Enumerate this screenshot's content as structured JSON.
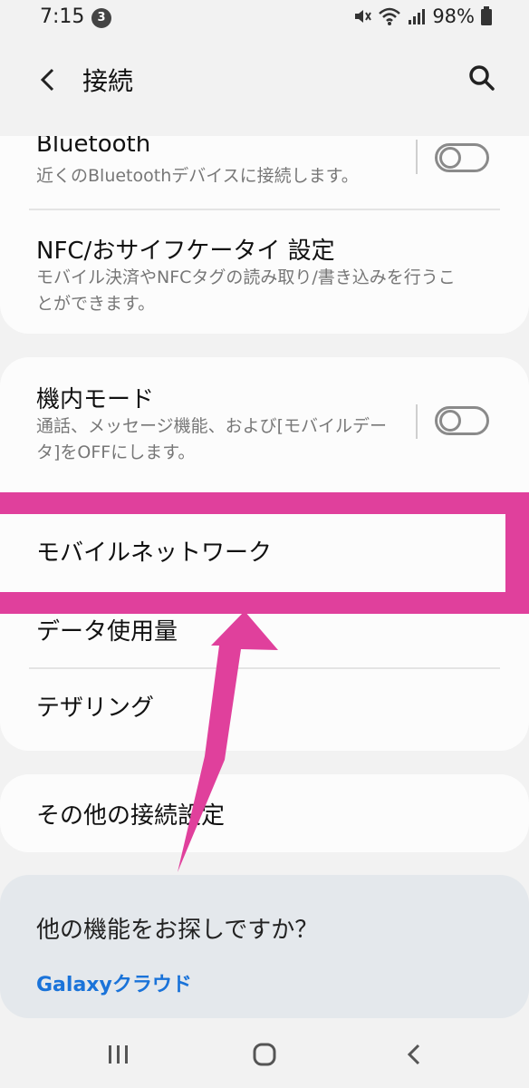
{
  "status_bar": {
    "time": "7:15",
    "notification_count": "3",
    "battery": "98%"
  },
  "header": {
    "title": "接続",
    "back_icon": "chevron-left-icon",
    "search_icon": "search-icon"
  },
  "settings": {
    "bluetooth": {
      "title": "Bluetooth",
      "subtitle": "近くのBluetoothデバイスに接続します。",
      "enabled": false
    },
    "nfc": {
      "title": "NFC/おサイフケータイ 設定",
      "subtitle": "モバイル決済やNFCタグの読み取り/書き込みを行うことができます。"
    },
    "airplane": {
      "title": "機内モード",
      "subtitle": "通話、メッセージ機能、および[モバイルデータ]をOFFにします。",
      "enabled": false
    },
    "mobile_network": {
      "title": "モバイルネットワーク"
    },
    "data_usage": {
      "title": "データ使用量"
    },
    "tethering": {
      "title": "テザリング"
    },
    "more_connections": {
      "title": "その他の接続設定"
    }
  },
  "suggestion": {
    "title": "他の機能をお探しですか？",
    "link": "Galaxyクラウド"
  },
  "colors": {
    "highlight": "#e0409c",
    "link": "#1a73d9",
    "background": "#f2f2f2",
    "card": "#fcfcfc"
  }
}
